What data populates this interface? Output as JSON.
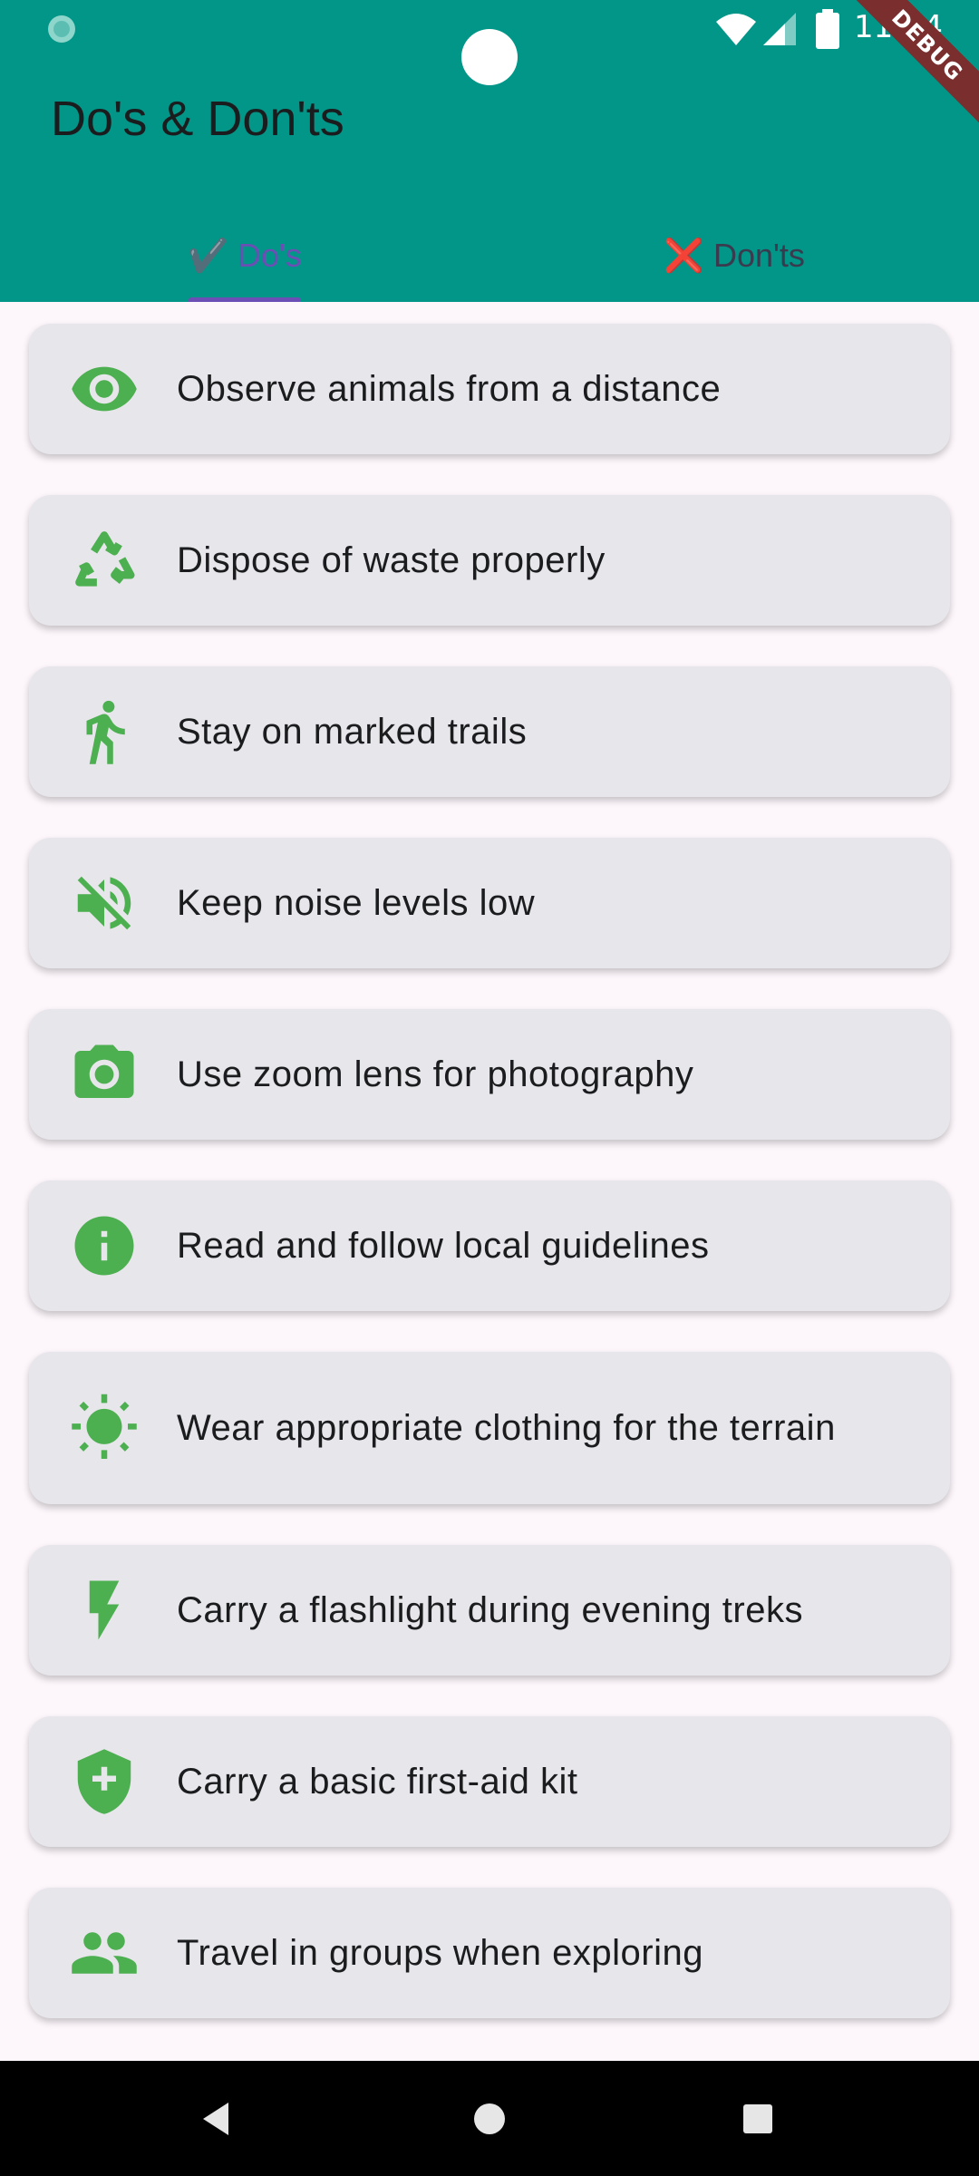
{
  "status_bar": {
    "time": "11:34",
    "debug_label": "DEBUG"
  },
  "app_bar": {
    "title": "Do's & Don'ts",
    "background_color": "#019688"
  },
  "tabs": [
    {
      "label": "✔️ Do's",
      "selected": true
    },
    {
      "label": "❌ Don'ts",
      "selected": false
    }
  ],
  "accent_color": "#6b4fb4",
  "icon_color": "#4caf50",
  "items": [
    {
      "icon": "eye-icon",
      "text": "Observe animals from a distance"
    },
    {
      "icon": "recycle-icon",
      "text": "Dispose of waste properly"
    },
    {
      "icon": "hiker-icon",
      "text": "Stay on marked trails"
    },
    {
      "icon": "volume-off-icon",
      "text": "Keep noise levels low"
    },
    {
      "icon": "camera-icon",
      "text": "Use zoom lens for photography"
    },
    {
      "icon": "info-icon",
      "text": "Read and follow local guidelines"
    },
    {
      "icon": "sun-icon",
      "text": "Wear appropriate clothing for the terrain"
    },
    {
      "icon": "flash-icon",
      "text": "Carry a flashlight during evening treks"
    },
    {
      "icon": "health-shield-icon",
      "text": "Carry a basic first-aid kit"
    },
    {
      "icon": "group-icon",
      "text": "Travel in groups when exploring"
    }
  ],
  "nav_bar": {
    "buttons": [
      "back-icon",
      "home-icon",
      "recents-icon"
    ]
  }
}
